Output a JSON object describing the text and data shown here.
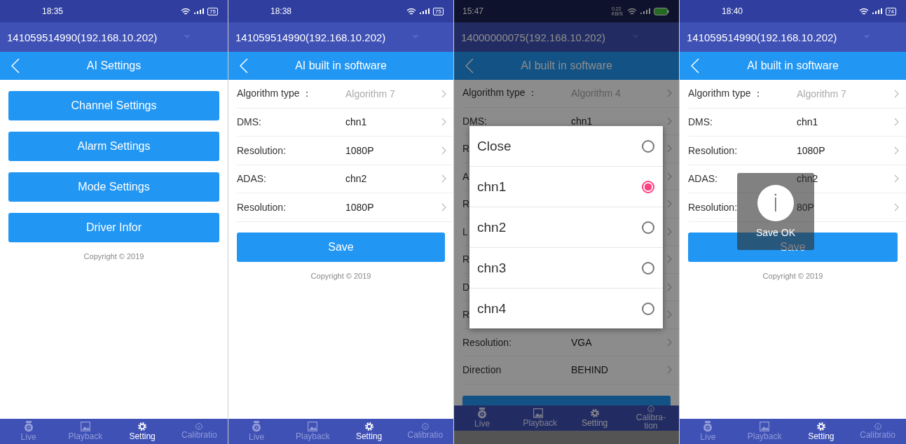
{
  "screens": [
    {
      "kind": "menu",
      "scrim": false,
      "status": {
        "time": "18:35",
        "battery": "75"
      },
      "device": "141059514990(192.168.10.202)",
      "title": "AI Settings",
      "buttons": [
        "Channel Settings",
        "Alarm Settings",
        "Mode Settings",
        "Driver Infor"
      ],
      "copyright": "Copyright © 2019",
      "nav": [
        {
          "label": "Live",
          "selected": false
        },
        {
          "label": "Playback",
          "selected": false
        },
        {
          "label": "Setting",
          "selected": true
        },
        {
          "label": "Calibratio",
          "selected": false
        }
      ]
    },
    {
      "kind": "form",
      "scrim": false,
      "status": {
        "time": "18:38",
        "battery": "75"
      },
      "device": "141059514990(192.168.10.202)",
      "title": "AI built in software",
      "rows": [
        {
          "kind": "type",
          "label": "Algorithm type ：",
          "value": "Algorithm 7"
        },
        {
          "kind": "field",
          "label": "DMS:",
          "value": "chn1"
        },
        {
          "kind": "field",
          "label": "Resolution:",
          "value": "1080P"
        },
        {
          "kind": "field",
          "label": "ADAS:",
          "value": "chn2"
        },
        {
          "kind": "field",
          "label": "Resolution:",
          "value": "1080P"
        }
      ],
      "save": "Save",
      "copyright": "Copyright © 2019",
      "nav": [
        {
          "label": "Live",
          "selected": false
        },
        {
          "label": "Playback",
          "selected": false
        },
        {
          "label": "Setting",
          "selected": true
        },
        {
          "label": "Calibratio",
          "selected": false
        }
      ]
    },
    {
      "kind": "dialog",
      "scrim": true,
      "status": {
        "time": "15:47",
        "speed": "0.22 KB/S"
      },
      "device": "14000000075(192.168.10.202)",
      "title": "AI built in software",
      "rows": [
        {
          "kind": "type",
          "label": "Algorithm type ：",
          "value": "Algorithm 4"
        },
        {
          "kind": "field",
          "label": "DMS:",
          "value": "chn1"
        },
        {
          "kind": "field",
          "label": "R"
        },
        {
          "kind": "field",
          "label": "A"
        },
        {
          "kind": "field",
          "label": "R"
        },
        {
          "kind": "field",
          "label": "L"
        },
        {
          "kind": "field",
          "label": "R"
        },
        {
          "kind": "field",
          "label": "D"
        },
        {
          "kind": "field",
          "label": "R"
        },
        {
          "kind": "field",
          "label": "Resolution:",
          "value": "VGA"
        },
        {
          "kind": "field",
          "label": "Direction",
          "value": "BEHIND"
        }
      ],
      "dialog": [
        {
          "label": "Close",
          "selected": false
        },
        {
          "label": "chn1",
          "selected": true
        },
        {
          "label": "chn2",
          "selected": false
        },
        {
          "label": "chn3",
          "selected": false
        },
        {
          "label": "chn4",
          "selected": false
        }
      ],
      "nav": [
        {
          "label": "Live",
          "selected": false
        },
        {
          "label": "Playback",
          "selected": false
        },
        {
          "label": "Setting",
          "selected": true
        },
        {
          "label": "Calibra-tion",
          "selected": false
        }
      ]
    },
    {
      "kind": "form",
      "scrim": false,
      "status": {
        "time": "18:40",
        "battery": "74"
      },
      "device": "141059514990(192.168.10.202)",
      "title": "AI built in software",
      "rows": [
        {
          "kind": "type",
          "label": "Algorithm type ：",
          "value": "Algorithm 7"
        },
        {
          "kind": "field",
          "label": "DMS:",
          "value": "chn1"
        },
        {
          "kind": "field",
          "label": "Resolution:",
          "value": "1080P"
        },
        {
          "kind": "field",
          "label": "ADAS:",
          "value": "chn2"
        },
        {
          "kind": "field",
          "label": "Resolution:",
          "value": "80P"
        }
      ],
      "save": "Save",
      "toast": "Save OK",
      "copyright": "Copyright © 2019",
      "nav": [
        {
          "label": "Live",
          "selected": false
        },
        {
          "label": "Playback",
          "selected": false
        },
        {
          "label": "Setting",
          "selected": true
        },
        {
          "label": "Calibratio",
          "selected": false
        }
      ]
    }
  ]
}
